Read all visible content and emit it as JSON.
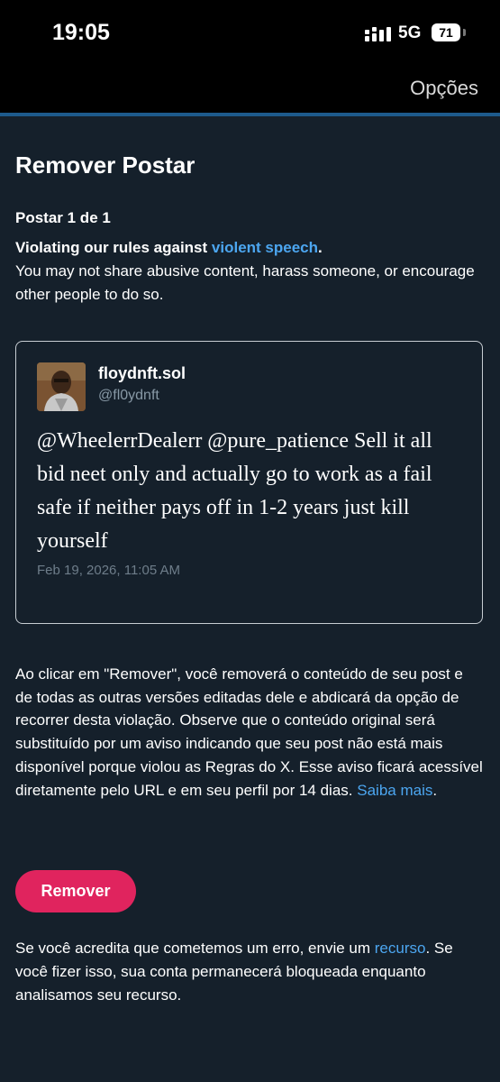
{
  "status_bar": {
    "time": "19:05",
    "network": "5G",
    "battery": "71"
  },
  "header": {
    "options_label": "Opções"
  },
  "page": {
    "title": "Remover Postar",
    "counter": "Postar 1 de 1",
    "violation_prefix": "Violating our rules against ",
    "violation_link": "violent speech",
    "violation_suffix": ".",
    "violation_detail": "You may not share abusive content, harass someone, or encourage other people to do so."
  },
  "post": {
    "author_name": "floydnft.sol",
    "author_handle": "@fl0ydnft",
    "text": "@WheelerrDealerr @pure_patience Sell it all bid neet only and actually go to work as a fail safe if neither pays off in 1-2 years just kill yourself",
    "timestamp": "Feb 19, 2026, 11:05 AM"
  },
  "explanation": {
    "text": "Ao clicar em \"Remover\", você removerá o conteúdo de seu post e de todas as outras versões editadas dele e abdicará da opção de recorrer desta violação. Observe que o conteúdo original será substituído por um aviso indicando que seu post não está mais disponível porque violou as Regras do X. Esse aviso ficará acessível diretamente pelo URL e em seu perfil por 14 dias. ",
    "learn_more_link": "Saiba mais",
    "end": "."
  },
  "remove_button_label": "Remover",
  "footer": {
    "prefix": "Se você acredita que cometemos um erro, envie um ",
    "appeal_link": "recurso",
    "suffix": ". Se você fizer isso, sua conta permanecerá bloqueada enquanto analisamos seu recurso."
  },
  "colors": {
    "background": "#15202b",
    "link": "#4ca6f0",
    "remove_button": "#e0245e",
    "accent_divider": "#1d5a8c"
  },
  "icons": [
    "cellular-signal-icon",
    "battery-icon",
    "avatar-image"
  ]
}
